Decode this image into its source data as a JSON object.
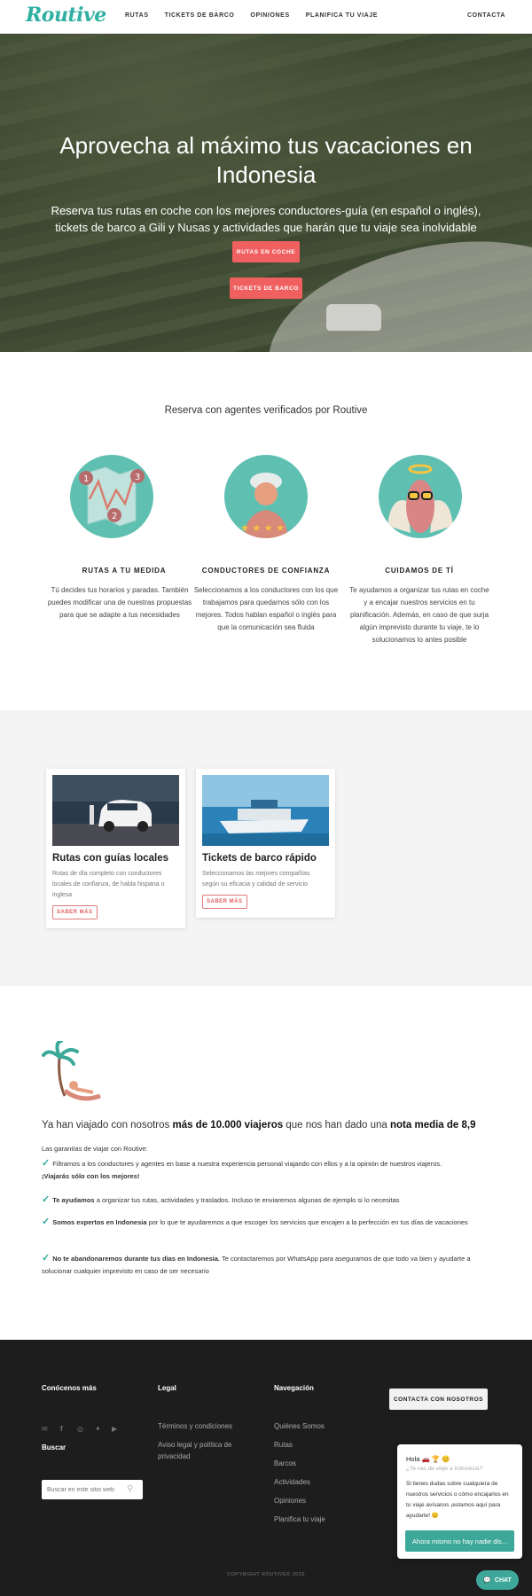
{
  "nav": {
    "logo": "Routive",
    "links": [
      "RUTAS",
      "TICKETS DE BARCO",
      "OPINIONES",
      "PLANIFICA TU VIAJE"
    ],
    "contact": "CONTACTA"
  },
  "hero": {
    "title": "Aprovecha al máximo tus vacaciones en Indonesia",
    "subtitle": "Reserva tus rutas en coche con los mejores conductores-guía (en español o inglés), tickets de barco a Gili y Nusas y actividades que harán que tu viaje sea inolvidable",
    "btn_routes": "RUTAS EN COCHE",
    "btn_tickets": "TICKETS DE BARCO"
  },
  "agents": {
    "title": "Reserva con agentes verificados por Routive",
    "features": [
      {
        "title": "RUTAS A TU MEDIDA",
        "text": "Tú decides tus horarios y paradas. También puedes modificar una de nuestras propuestas para que se adapte a tus necesidades",
        "icon": "map-icon"
      },
      {
        "title": "CONDUCTORES DE CONFIANZA",
        "text": "Seleccionamos a los conductores con los que trabajamos para quedarnos sólo con los mejores. Todos hablan español o inglés para que la comunicación sea fluida",
        "icon": "driver-icon"
      },
      {
        "title": "CUIDAMOS DE TÍ",
        "text": "Te ayudamos a organizar tus rutas en coche y a encajar nuestros servicios en tu planificación. Además, en caso de que surja algún imprevisto durante tu viaje, te lo solucionamos lo antes posible",
        "icon": "angel-icon"
      }
    ]
  },
  "cards": [
    {
      "title": "Rutas con guías locales",
      "text": "Rutas de día completo con conductores locales de confianza, de habla hispana o inglesa",
      "button": "SABER MÁS"
    },
    {
      "title": "Tickets de barco rápido",
      "text": "Seleccionamos las mejores compañías según su eficacia y calidad de servicio",
      "button": "SABER MÁS"
    }
  ],
  "trust": {
    "title_pre": "Ya han viajado con nosotros ",
    "title_b1": "más de 10.000 viajeros",
    "title_mid": " que nos han dado una ",
    "title_b2": "nota media de 8,9",
    "intro": "Las garantías de viajar con Routive:",
    "items": [
      {
        "bold": "",
        "text": "Filtramos a los conductores y agentes en base a nuestra experiencia personal viajando con ellos y a la opinión de nuestros viajeros.",
        "bold2": "¡Viajarás sólo con los mejores!"
      },
      {
        "bold": "Te ayudamos",
        "text": " a organizar tus rutas, actividades y traslados. Incluso te enviaremos algunas de ejemplo si lo necesitas",
        "bold2": ""
      },
      {
        "bold": "Somos expertos en Indonesia",
        "text": " por lo que te ayudaremos a que escoger los servicios que encajen a la perfección en tus días de vacaciones",
        "bold2": ""
      },
      {
        "bold": "No te abandonaremos durante tus días en Indonesia.",
        "text": " Te contactaremos por WhatsApp para aseguramos de que todo va bien y ayudarte a solucionar cualquier imprevisto en caso de ser necesario",
        "bold2": ""
      }
    ]
  },
  "footer": {
    "col1_head": "Conócenos más",
    "col2_head": "Legal",
    "col3_head": "Navegación",
    "legal_links": [
      "Términos y condiciones",
      "Aviso legal y política de privacidad"
    ],
    "nav_links": [
      "Quiénes Somos",
      "Rutas",
      "Barcos",
      "Actividades",
      "Opiniones",
      "Planifica tu viaje"
    ],
    "search_head": "Buscar",
    "search_placeholder": "Buscar en este sitio web",
    "contact_btn": "CONTACTA CON NOSOTROS",
    "copyright": "COPYRIGHT ROUTIVE© 2020",
    "social_icons": [
      "email-icon",
      "facebook-icon",
      "instagram-icon",
      "twitter-icon",
      "youtube-icon"
    ]
  },
  "chat": {
    "hello": "Hola 🚗 🏆 😊",
    "question": "¿Te vas de viaje a Indonesia?",
    "message": "Si tienes dudas sobre cualquiera de nuestros servicios o cómo encajarlos en tu viaje avísanos ¡estamos aquí para ayudarte! 😊",
    "button": "Ahora mismo no hay nadie dis...",
    "bubble": "CHAT"
  },
  "colors": {
    "teal": "#2fb0a2",
    "coral": "#f06060",
    "footer": "#1d1d1d"
  }
}
